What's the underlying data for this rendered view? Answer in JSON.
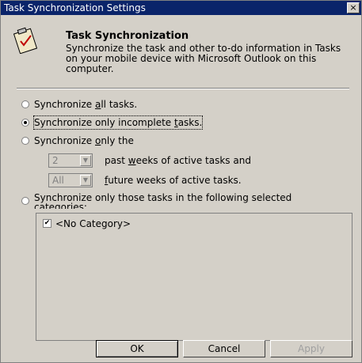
{
  "window": {
    "title": "Task Synchronization Settings",
    "close_label": "×"
  },
  "header": {
    "icon": "clipboard-check-icon",
    "title": "Task Synchronization",
    "description": "Synchronize the task and other to-do information in Tasks on your mobile device with Microsoft Outlook on this computer."
  },
  "options": {
    "all": {
      "prefix": "Synchronize ",
      "accel": "a",
      "suffix": "ll tasks.",
      "checked": false
    },
    "incomplete": {
      "prefix": "Synchronize only incomplete ",
      "accel": "t",
      "suffix": "asks.",
      "checked": true
    },
    "only_the": {
      "prefix": "Synchronize ",
      "accel": "o",
      "suffix": "nly the",
      "checked": false
    },
    "past": {
      "value": "2",
      "prefix": "past ",
      "accel": "w",
      "suffix": "eeks of active tasks and"
    },
    "future": {
      "value": "All",
      "prefix": "",
      "accel": "f",
      "suffix": "uture weeks of active tasks."
    },
    "categories": {
      "label": "Synchronize only those tasks in the following selected categories:",
      "checked": false
    }
  },
  "categories_list": [
    {
      "label": "<No Category>",
      "checked": true
    }
  ],
  "buttons": {
    "ok": "OK",
    "cancel": "Cancel",
    "apply": "Apply"
  },
  "colors": {
    "titlebar": "#0a246a",
    "face": "#d4d0c8"
  }
}
